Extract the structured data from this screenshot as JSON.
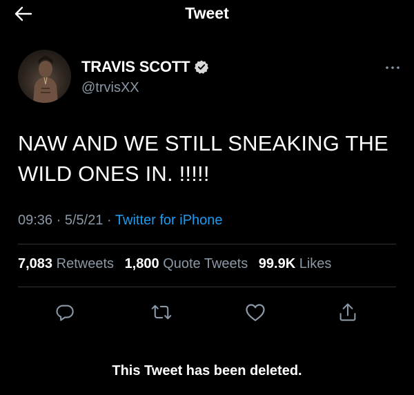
{
  "header": {
    "title": "Tweet",
    "back_icon": "arrow-left-icon"
  },
  "author": {
    "name": "TRAVIS SCOTT",
    "handle": "@trvisXX",
    "verified": true,
    "verified_color": "#d9d9d9"
  },
  "tweet": {
    "line1": "NAW AND WE STILL SNEAKING THE",
    "line2": "WILD ONES IN. !!!!!"
  },
  "meta": {
    "time": "09:36",
    "date": "5/5/21",
    "source": "Twitter for iPhone",
    "separator": "·"
  },
  "stats": {
    "retweets_count": "7,083",
    "retweets_label": "Retweets",
    "quotes_count": "1,800",
    "quotes_label": "Quote Tweets",
    "likes_count": "99.9K",
    "likes_label": "Likes"
  },
  "actions": [
    "reply-icon",
    "retweet-icon",
    "like-icon",
    "share-icon"
  ],
  "footer": {
    "deleted_notice": "This Tweet has been deleted."
  },
  "colors": {
    "background": "#000000",
    "text": "#ffffff",
    "secondary": "#8b98a5",
    "accent": "#1d9bf0",
    "divider": "#2f3336"
  }
}
